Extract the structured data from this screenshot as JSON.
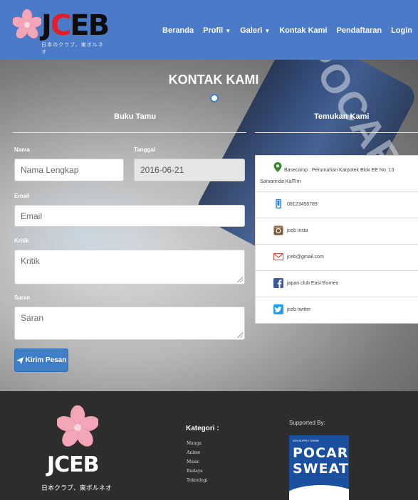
{
  "brand": {
    "logo_text_prefix": "J",
    "logo_text_red": "C",
    "logo_text_suffix": "EB",
    "logo_subtitle": "日本のクラブ、東ボルネオ"
  },
  "nav": {
    "items": [
      {
        "label": "Beranda",
        "dropdown": false
      },
      {
        "label": "Profil",
        "dropdown": true
      },
      {
        "label": "Galeri",
        "dropdown": true
      },
      {
        "label": "Kontak Kami",
        "dropdown": false
      },
      {
        "label": "Pendaftaran",
        "dropdown": false
      },
      {
        "label": "Login",
        "dropdown": false
      }
    ]
  },
  "page": {
    "title": "KONTAK KAMI",
    "guestbook_heading": "Buku Tamu",
    "find_us_heading": "Temukan Kami"
  },
  "form": {
    "name_label": "Nama",
    "name_placeholder": "Nama Lengkap",
    "date_label": "Tanggal",
    "date_value": "2016-06-21",
    "email_label": "Email",
    "email_placeholder": "Email",
    "critique_label": "Kritik",
    "critique_placeholder": "Kritik",
    "suggestion_label": "Saran",
    "suggestion_placeholder": "Saran",
    "submit_label": "Kirim Pesan"
  },
  "contacts": {
    "address_line1": "Basecamp : Perumahan Karpotek Blok EE No. 13",
    "address_line2": "Samarinda KalTim",
    "phone": "08123456789",
    "instagram": "jceb insta",
    "email": "jceb@gmail.com",
    "facebook": "japan club East Borneo",
    "twitter": "jceb twitter"
  },
  "footer": {
    "logo_text": "JCEB",
    "logo_subtitle": "日本クラブ、東ボルネオ",
    "category_title": "Kategori :",
    "categories": [
      "Manga",
      "Anime",
      "Music",
      "Budaya",
      "Teknologi"
    ],
    "supported_by": "Supported By:",
    "sponsor_small": "ION SUPPLY DRINK",
    "sponsor_line1": "POCARI",
    "sponsor_line2": "SWEAT"
  },
  "hero": {
    "can_text": "POCARI"
  },
  "colors": {
    "navbar": "#4a7ac8",
    "primary_button": "#3f7fc7",
    "footer": "#2d2d2d",
    "logo_red": "#e41e26",
    "pin_green": "#3a8b2c",
    "instagram_brown": "#7a5a3c",
    "email_red": "#d9534f",
    "facebook_blue": "#3b5998",
    "twitter_blue": "#1da1f2",
    "phone_blue": "#2a7fd1"
  }
}
